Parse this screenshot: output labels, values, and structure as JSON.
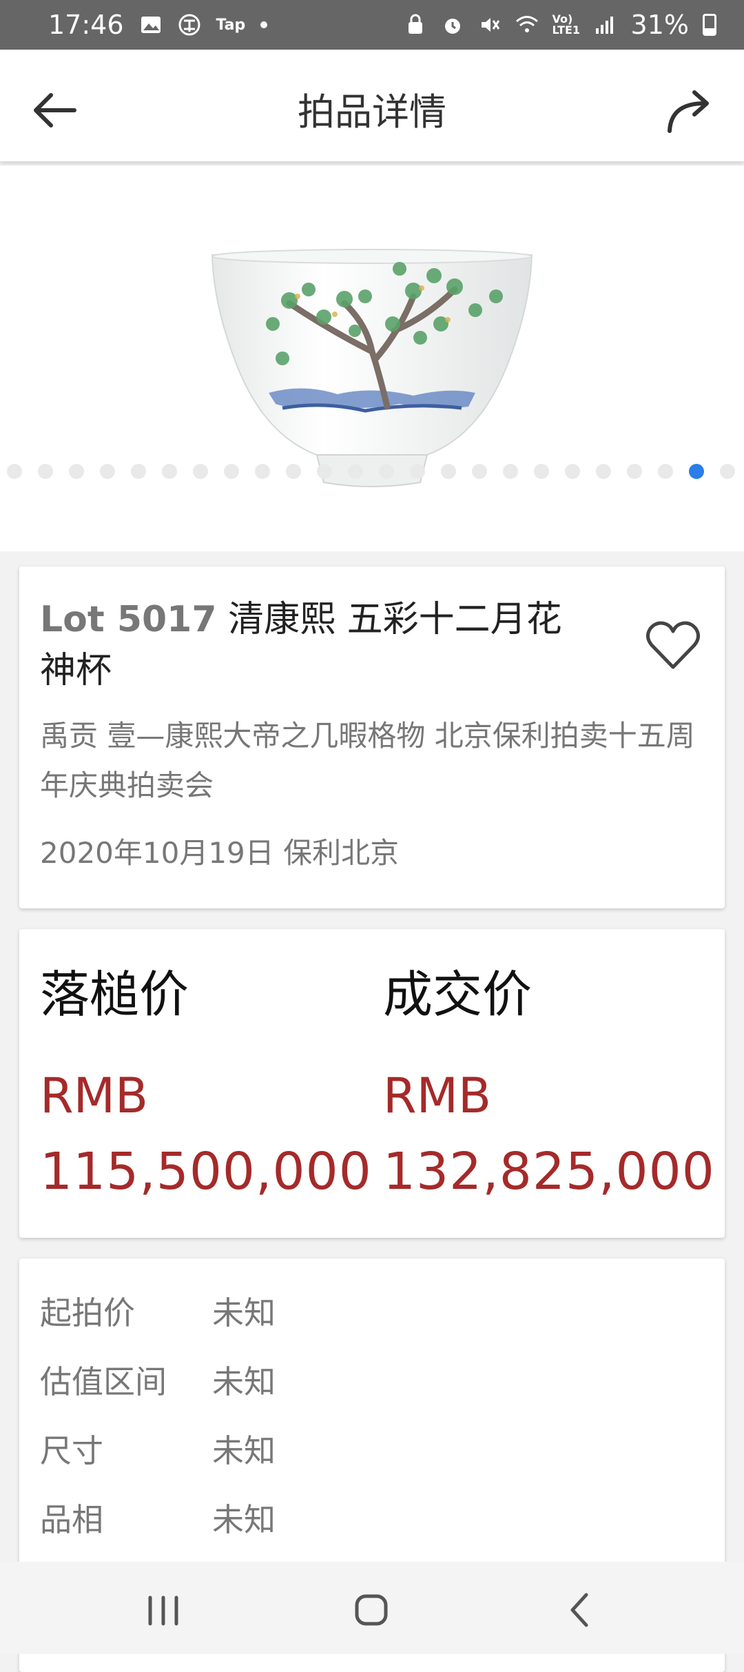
{
  "status_bar": {
    "time": "17:46",
    "tap_label": "Tap",
    "volte_label": "Vo) LTE1",
    "battery": "31%"
  },
  "header": {
    "title": "拍品详情"
  },
  "carousel": {
    "dot_count": 24,
    "active_index": 22
  },
  "lot": {
    "number": "Lot 5017",
    "name": "清康熙 五彩十二月花神杯",
    "subtitle": "禹贡 壹—康熙大帝之几暇格物 北京保利拍卖十五周年庆典拍卖会",
    "date_place": "2020年10月19日 保利北京"
  },
  "prices": {
    "hammer_label": "落槌价",
    "hammer_currency": "RMB",
    "hammer_value": "115,500,000",
    "deal_label": "成交价",
    "deal_currency": "RMB",
    "deal_value": "132,825,000"
  },
  "info": {
    "rows": [
      {
        "label": "起拍价",
        "value": "未知"
      },
      {
        "label": "估值区间",
        "value": "未知"
      },
      {
        "label": "尺寸",
        "value": "未知"
      },
      {
        "label": "品相",
        "value": "未知"
      }
    ]
  },
  "colors": {
    "price_red": "#a52a2a",
    "dot_active": "#2b7de9",
    "status_bar": "#666666"
  },
  "icons": {
    "back": "arrow-left-icon",
    "share": "share-arrow-icon",
    "favorite": "heart-outline-icon",
    "nav_recent": "recent-apps-icon",
    "nav_home": "home-icon",
    "nav_back": "chevron-left-icon"
  }
}
